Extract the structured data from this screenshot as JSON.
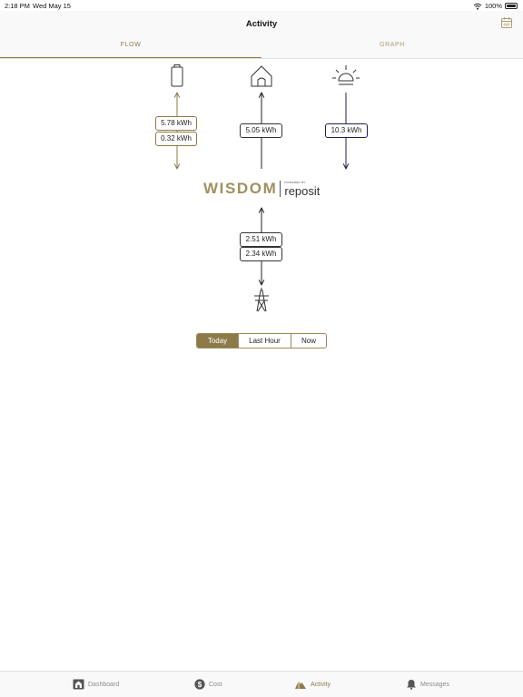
{
  "status_bar": {
    "time": "2:18 PM",
    "date": "Wed May 15",
    "battery_percent": "100%"
  },
  "header": {
    "title": "Activity",
    "tabs": [
      {
        "label": "FLOW",
        "active": true
      },
      {
        "label": "GRAPH",
        "active": false
      }
    ]
  },
  "flow": {
    "battery": {
      "charge": "5.78 kWh",
      "discharge": "0.32 kWh"
    },
    "home": {
      "consumption": "5.05 kWh"
    },
    "solar": {
      "generation": "10.3 kWh"
    },
    "grid": {
      "import": "2.51 kWh",
      "export": "2.34 kWh"
    }
  },
  "logo": {
    "brand": "WISDOM",
    "powered_by": "POWERED BY",
    "partner": "reposit"
  },
  "period_selector": {
    "options": [
      "Today",
      "Last Hour",
      "Now"
    ],
    "selected": "Today"
  },
  "tab_bar": {
    "items": [
      {
        "label": "Dashboard",
        "icon": "house-icon"
      },
      {
        "label": "Cost",
        "icon": "dollar-coin-icon"
      },
      {
        "label": "Activity",
        "icon": "activity-icon",
        "active": true
      },
      {
        "label": "Messages",
        "icon": "bell-icon"
      }
    ]
  },
  "colors": {
    "accent_gold": "#8c7a49",
    "solar_navy": "#1f1f4e",
    "line_dark": "#222222"
  }
}
